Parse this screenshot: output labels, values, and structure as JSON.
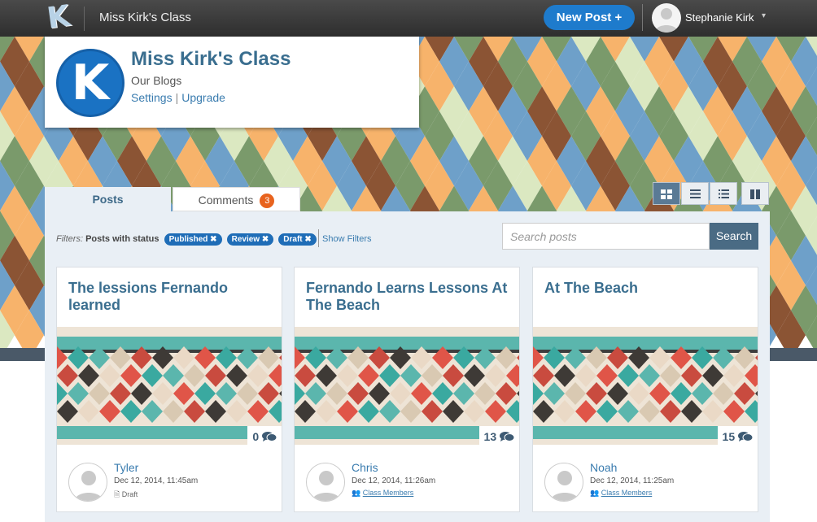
{
  "topbar": {
    "logo_letter": "K",
    "class_name": "Miss Kirk's Class",
    "new_post_label": "New Post",
    "new_post_plus": "+",
    "user_name": "Stephanie Kirk",
    "caret": "▾"
  },
  "class_card": {
    "logo_letter": "K",
    "title": "Miss Kirk's Class",
    "subtitle": "Our Blogs",
    "settings_link": "Settings",
    "separator": "|",
    "upgrade_link": "Upgrade"
  },
  "tabs": [
    {
      "label": "Posts"
    },
    {
      "label": "Comments",
      "badge": "3"
    }
  ],
  "view_icons": [
    "grid-view-icon",
    "list-view-icon",
    "compact-list-icon",
    "split-view-icon"
  ],
  "filters": {
    "label": "Filters:",
    "status_text": "Posts with status",
    "chips": [
      "Published ✖",
      "Review ✖",
      "Draft ✖"
    ],
    "show_filters": "Show Filters"
  },
  "search": {
    "placeholder": "Search posts",
    "button": "Search"
  },
  "posts": [
    {
      "title": "The lessions Fernando learned",
      "comments": "0",
      "author": "Tyler",
      "date": "Dec 12, 2014, 11:45am",
      "status": "Draft"
    },
    {
      "title": "Fernando Learns Lessons At The Beach",
      "comments": "13",
      "author": "Chris",
      "date": "Dec 12, 2014, 11:26am",
      "status": "Class Members"
    },
    {
      "title": "At The Beach",
      "comments": "15",
      "author": "Noah",
      "date": "Dec 12, 2014, 11:25am",
      "status": "Class Members"
    }
  ],
  "colors": {
    "accent": "#1e7bcc",
    "title": "#3a6e8f",
    "badge": "#e8631e",
    "panel": "#e9eff5"
  }
}
